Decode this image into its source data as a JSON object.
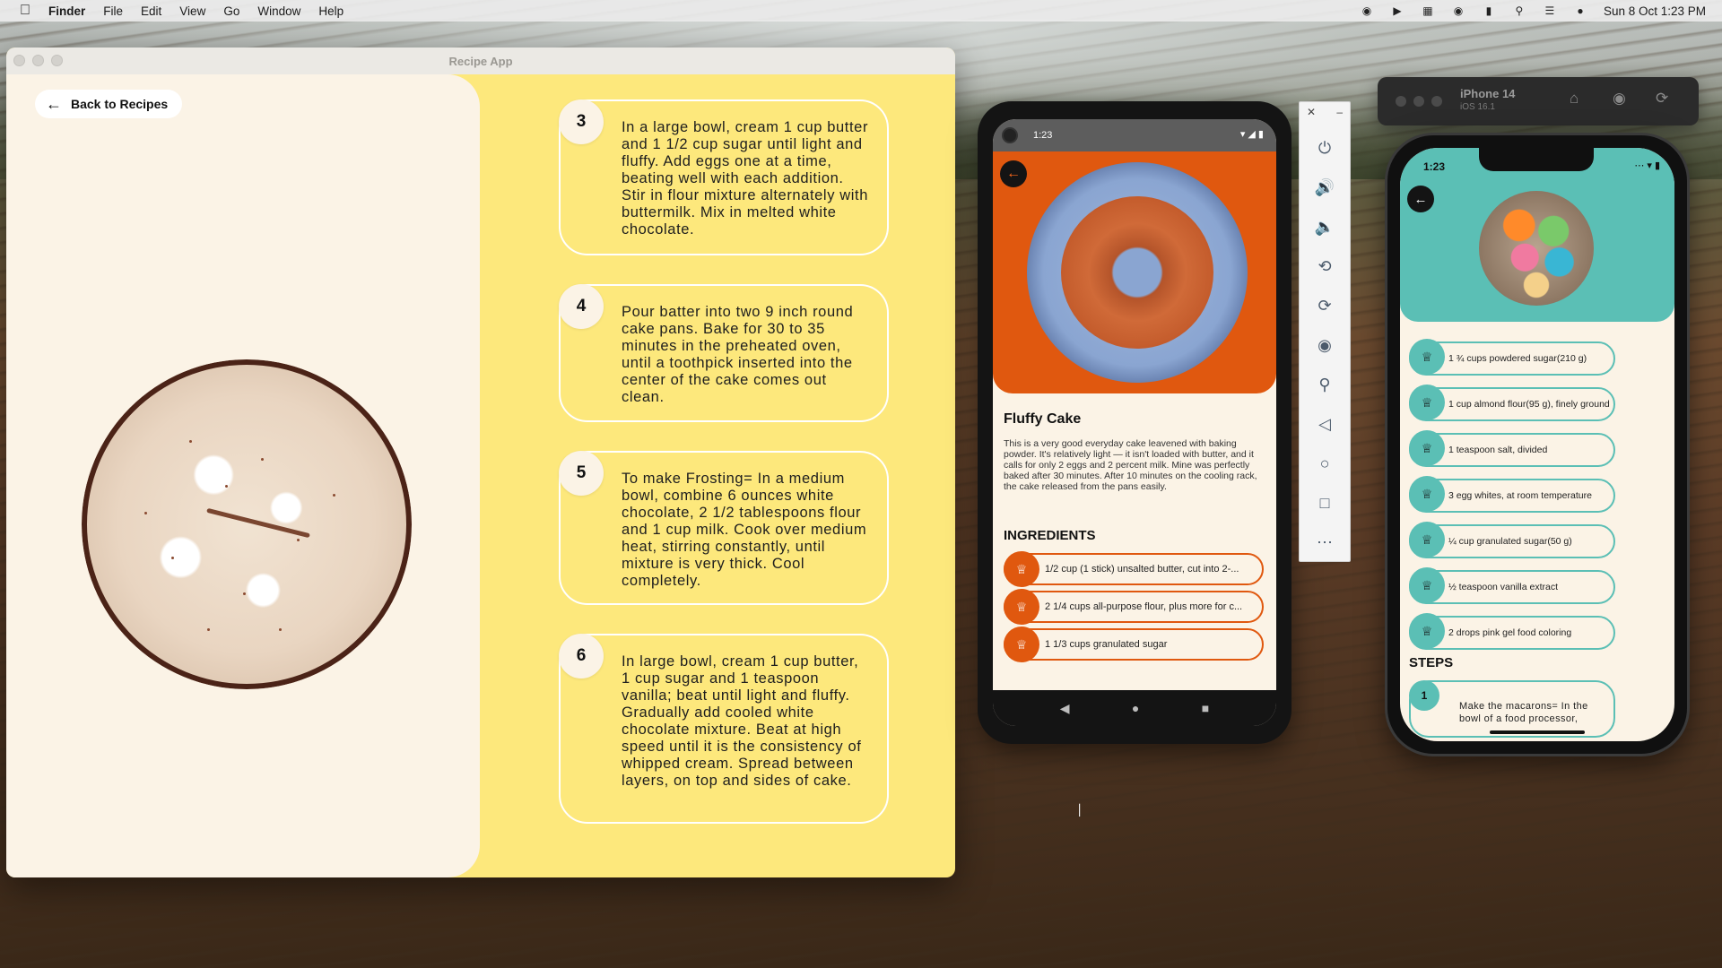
{
  "menubar": {
    "app": "Finder",
    "items": [
      "File",
      "Edit",
      "View",
      "Go",
      "Window",
      "Help"
    ],
    "datetime": "Sun 8 Oct  1:23 PM",
    "status_icons": [
      "record-icon",
      "play-icon",
      "calendar-icon",
      "headphones-icon",
      "battery-icon",
      "search-icon",
      "control-center-icon",
      "siri-icon"
    ]
  },
  "recipe_window": {
    "title": "Recipe App",
    "back_label": "Back to Recipes",
    "steps": [
      {
        "num": "3",
        "text": "In a large bowl, cream 1 cup butter and 1 1/2 cup sugar until light and fluffy. Add eggs one at a time, beating well with each addition. Stir in flour mixture alternately with buttermilk. Mix in melted white chocolate."
      },
      {
        "num": "4",
        "text": "Pour batter into two 9 inch round cake pans. Bake for 30 to 35 minutes in the preheated oven, until a toothpick inserted into the center of the cake comes out clean."
      },
      {
        "num": "5",
        "text": "To make Frosting= In a medium bowl, combine 6 ounces white chocolate, 2 1/2 tablespoons flour and 1 cup milk. Cook over medium heat, stirring constantly, until mixture is very thick. Cool completely."
      },
      {
        "num": "6",
        "text": "In large bowl, cream 1 cup butter, 1 cup sugar and 1 teaspoon vanilla; beat until light and fluffy. Gradually add cooled white chocolate mixture. Beat at high speed until it is the consistency of whipped cream. Spread between layers, on top and sides of cake."
      }
    ],
    "colors": {
      "accent": "#fde87c",
      "panel": "#fbf3e6"
    }
  },
  "android": {
    "time": "1:23",
    "recipe_title": "Fluffy Cake",
    "description": "This is a very good everyday cake leavened with baking powder. It's relatively light — it isn't loaded with butter, and it calls for only 2 eggs and 2 percent milk. Mine was perfectly baked after 30 minutes. After 10 minutes on the cooling rack, the cake released from the pans easily.",
    "ingredients_heading": "INGREDIENTS",
    "ingredients": [
      "1/2 cup (1 stick) unsalted butter, cut into 2-...",
      "2 1/4 cups all-purpose flour, plus more for c...",
      "1 1/3 cups granulated sugar"
    ],
    "accent": "#e0580f"
  },
  "emulator_toolbar": {
    "tools": [
      "power-icon",
      "volume-up-icon",
      "volume-down-icon",
      "rotate-left-icon",
      "rotate-right-icon",
      "camera-icon",
      "zoom-icon",
      "back-icon",
      "home-icon",
      "overview-icon",
      "more-icon"
    ]
  },
  "ios": {
    "device": "iPhone 14",
    "version": "iOS 16.1",
    "time": "1:23",
    "ingredients": [
      "1 ¾ cups powdered sugar(210 g)",
      "1 cup almond flour(95 g), finely ground",
      "1 teaspoon salt, divided",
      "3 egg whites, at room temperature",
      "¼ cup granulated sugar(50 g)",
      "½ teaspoon vanilla extract",
      "2 drops pink gel food coloring"
    ],
    "steps_heading": "STEPS",
    "first_step": {
      "num": "1",
      "text": "Make the macarons= In the bowl of a food processor,"
    },
    "accent": "#5bbfb5"
  }
}
